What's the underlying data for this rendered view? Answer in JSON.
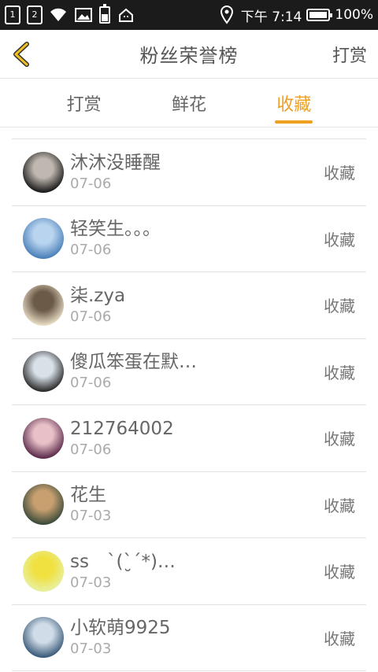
{
  "status_bar": {
    "sim1": "1",
    "sim2": "2",
    "time": "下午 7:14",
    "battery": "100%"
  },
  "header": {
    "title": "粉丝荣誉榜",
    "right_button": "打赏",
    "back_icon": "chevron-left-icon",
    "accent_color": "#f0a020"
  },
  "tabs": [
    {
      "label": "打赏",
      "active": false
    },
    {
      "label": "鲜花",
      "active": false
    },
    {
      "label": "收藏",
      "active": true
    }
  ],
  "rows": [
    {
      "name": "沐沐没睡醒",
      "date": "07-06",
      "action": "收藏",
      "avatar_colors": [
        "#1a1a1a",
        "#c0b8b0"
      ]
    },
    {
      "name": "轻笑生。。。",
      "date": "07-06",
      "action": "收藏",
      "avatar_colors": [
        "#4a7fb8",
        "#b9d4ef"
      ]
    },
    {
      "name": "柒.zya",
      "date": "07-06",
      "action": "收藏",
      "avatar_colors": [
        "#e8dcc4",
        "#6b5a48"
      ]
    },
    {
      "name": "傻瓜笨蛋在默…",
      "date": "07-06",
      "action": "收藏",
      "avatar_colors": [
        "#2a2a2a",
        "#d8e0e8"
      ]
    },
    {
      "name": "212764002",
      "date": "07-06",
      "action": "收藏",
      "avatar_colors": [
        "#5a2a4a",
        "#e8c0c8"
      ]
    },
    {
      "name": "花生",
      "date": "07-03",
      "action": "收藏",
      "avatar_colors": [
        "#3a4a3a",
        "#c8a070"
      ]
    },
    {
      "name": "ss　ˋ(ˋ̮ˊ*)…",
      "date": "07-03",
      "action": "收藏",
      "avatar_colors": [
        "#e8f0a0",
        "#f0e040"
      ]
    },
    {
      "name": "小软萌9925",
      "date": "07-03",
      "action": "收藏",
      "avatar_colors": [
        "#3a5a78",
        "#d0dce8"
      ]
    }
  ]
}
